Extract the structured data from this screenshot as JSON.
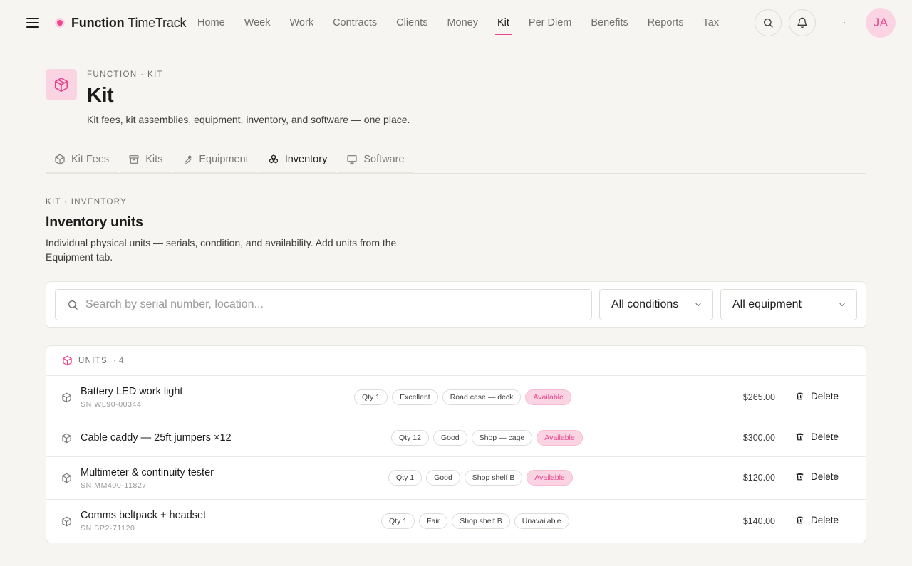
{
  "brand": {
    "strong": "Function",
    "light": "TimeTrack"
  },
  "nav": [
    "Home",
    "Week",
    "Work",
    "Contracts",
    "Clients",
    "Money",
    "Kit",
    "Per Diem",
    "Benefits",
    "Reports",
    "Tax"
  ],
  "nav_active": "Kit",
  "user": {
    "initials": "JA"
  },
  "header": {
    "eyebrow": "FUNCTION · KIT",
    "title": "Kit",
    "description": "Kit fees, kit assemblies, equipment, inventory, and software — one place."
  },
  "tabs": [
    {
      "label": "Kit Fees",
      "icon": "box-icon"
    },
    {
      "label": "Kits",
      "icon": "archive-icon"
    },
    {
      "label": "Equipment",
      "icon": "wrench-icon"
    },
    {
      "label": "Inventory",
      "icon": "boxes-icon"
    },
    {
      "label": "Software",
      "icon": "monitor-icon"
    }
  ],
  "active_tab": "Inventory",
  "section": {
    "eyebrow": "KIT · INVENTORY",
    "title": "Inventory units",
    "description": "Individual physical units — serials, condition, and availability. Add units from the Equipment tab."
  },
  "filters": {
    "search_placeholder": "Search by serial number, location...",
    "condition": "All conditions",
    "equipment": "All equipment"
  },
  "units": {
    "label": "UNITS",
    "count": "· 4",
    "rows": [
      {
        "name": "Battery LED work light",
        "serial": "SN WL90-00344",
        "qty": "Qty 1",
        "condition": "Excellent",
        "location": "Road case — deck",
        "status": "Available",
        "price": "$265.00",
        "delete_label": "Delete"
      },
      {
        "name": "Cable caddy — 25ft jumpers ×12",
        "serial": "",
        "qty": "Qty 12",
        "condition": "Good",
        "location": "Shop — cage",
        "status": "Available",
        "price": "$300.00",
        "delete_label": "Delete"
      },
      {
        "name": "Multimeter & continuity tester",
        "serial": "SN MM400-11827",
        "qty": "Qty 1",
        "condition": "Good",
        "location": "Shop shelf B",
        "status": "Available",
        "price": "$120.00",
        "delete_label": "Delete"
      },
      {
        "name": "Comms beltpack + headset",
        "serial": "SN BP2-71120",
        "qty": "Qty 1",
        "condition": "Fair",
        "location": "Shop shelf B",
        "status": "Unavailable",
        "price": "$140.00",
        "delete_label": "Delete"
      }
    ]
  },
  "colors": {
    "accent": "#f0458f",
    "accent_soft": "#fbd4e3",
    "background": "#f6f5f2"
  }
}
